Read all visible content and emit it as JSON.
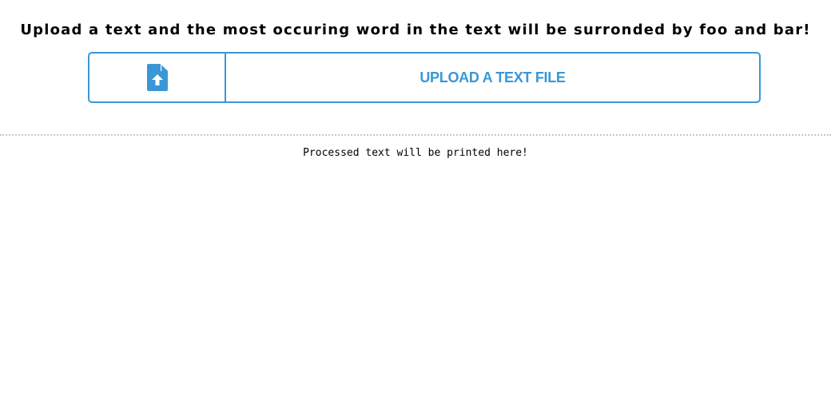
{
  "header": {
    "title": "Upload a text and the most occuring word in the text will be surronded by foo and bar!"
  },
  "upload": {
    "label": "UPLOAD A TEXT FILE",
    "icon": "file-upload-icon",
    "accent_color": "#3a97d5"
  },
  "output": {
    "text": "Processed text will be printed here!"
  }
}
